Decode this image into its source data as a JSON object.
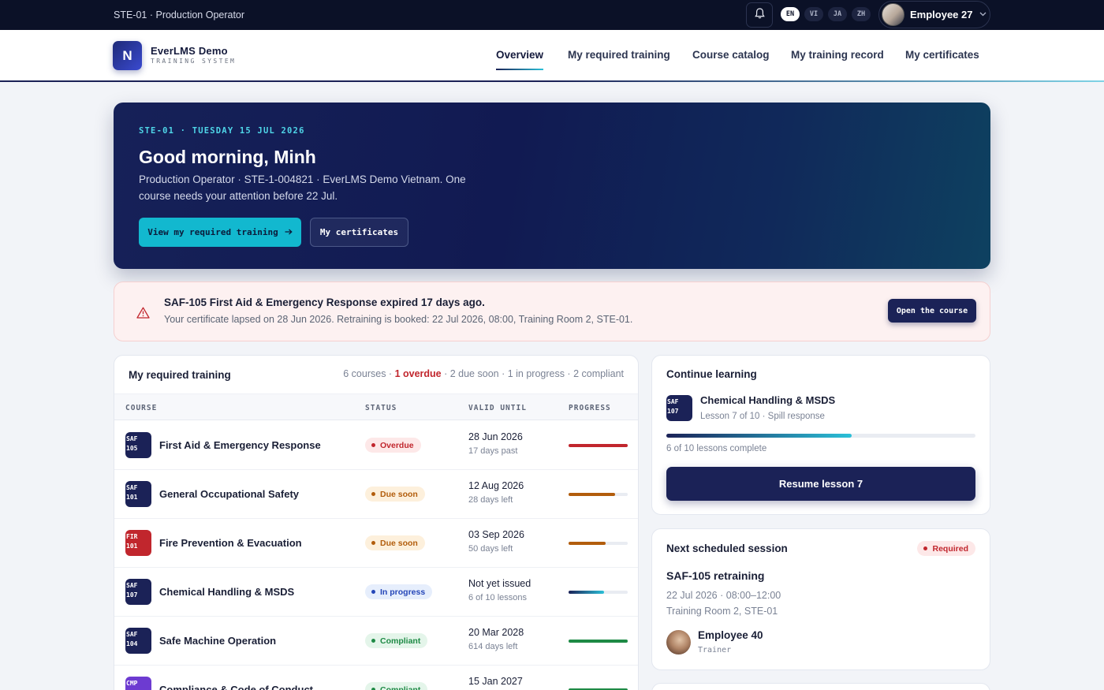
{
  "topbar": {
    "context": "STE-01 · Production Operator",
    "languages": [
      "EN",
      "VI",
      "JA",
      "ZH"
    ],
    "active_language": "EN",
    "user_name": "Employee 27"
  },
  "brand": {
    "name": "EverLMS Demo",
    "tagline": "TRAINING SYSTEM",
    "logo_letter": "N"
  },
  "nav": {
    "items": [
      "Overview",
      "My required training",
      "Course catalog",
      "My training record",
      "My certificates"
    ],
    "active": "Overview"
  },
  "hero": {
    "dateline": "STE-01 · TUESDAY 15 JUL 2026",
    "greeting": "Good morning, Minh",
    "description": "Production Operator · STE-1-004821 · EverLMS Demo Vietnam. One course needs your attention before 22 Jul.",
    "primary_button": "View my required training",
    "secondary_button": "My certificates"
  },
  "alert": {
    "title": "SAF-105 First Aid & Emergency Response expired 17 days ago.",
    "body": "Your certificate lapsed on 28 Jun 2026. Retraining is booked: 22 Jul 2026, 08:00, Training Room 2, STE-01.",
    "button": "Open the course"
  },
  "training": {
    "title": "My required training",
    "summary_pre": "6 courses · ",
    "summary_overdue": "1 overdue",
    "summary_post": " · 2 due soon · 1 in progress · 2 compliant",
    "columns": [
      "COURSE",
      "STATUS",
      "VALID UNTIL",
      "PROGRESS"
    ],
    "rows": [
      {
        "code1": "SAF",
        "code2": "105",
        "name": "First Aid & Emergency Response",
        "status": "Overdue",
        "valid": "28 Jun 2026",
        "sub": "17 days past",
        "progress": 1.0
      },
      {
        "code1": "SAF",
        "code2": "101",
        "name": "General Occupational Safety",
        "status": "Due soon",
        "valid": "12 Aug 2026",
        "sub": "28 days left",
        "progress": 0.78
      },
      {
        "code1": "FIR",
        "code2": "101",
        "name": "Fire Prevention & Evacuation",
        "status": "Due soon",
        "valid": "03 Sep 2026",
        "sub": "50 days left",
        "progress": 0.62
      },
      {
        "code1": "SAF",
        "code2": "107",
        "name": "Chemical Handling & MSDS",
        "status": "In progress",
        "valid": "Not yet issued",
        "sub": "6 of 10 lessons",
        "progress": 0.6
      },
      {
        "code1": "SAF",
        "code2": "104",
        "name": "Safe Machine Operation",
        "status": "Compliant",
        "valid": "20 Mar 2028",
        "sub": "614 days left",
        "progress": 1.0
      },
      {
        "code1": "CMP",
        "code2": "",
        "name": "Compliance & Code of Conduct",
        "status": "Compliant",
        "valid": "15 Jan 2027",
        "sub": "",
        "progress": 1.0
      }
    ]
  },
  "continue": {
    "title": "Continue learning",
    "code1": "SAF",
    "code2": "107",
    "course": "Chemical Handling & MSDS",
    "lesson": "Lesson 7 of 10 · Spill response",
    "progress": 0.6,
    "lessons_complete": "6 of 10 lessons complete",
    "button": "Resume lesson 7"
  },
  "next_session": {
    "title": "Next scheduled session",
    "badge": "Required",
    "session": "SAF-105 retraining",
    "when": "22 Jul 2026 · 08:00–12:00",
    "where": "Training Room 2, STE-01",
    "trainer_name": "Employee 40",
    "trainer_role": "Trainer"
  },
  "colors": {
    "navy": "#1b2257",
    "accent": "#12b8cf",
    "overdue": "#c1262d",
    "due": "#b25d0c",
    "in_progress": "#2546b8",
    "compliant": "#1e8a45"
  }
}
